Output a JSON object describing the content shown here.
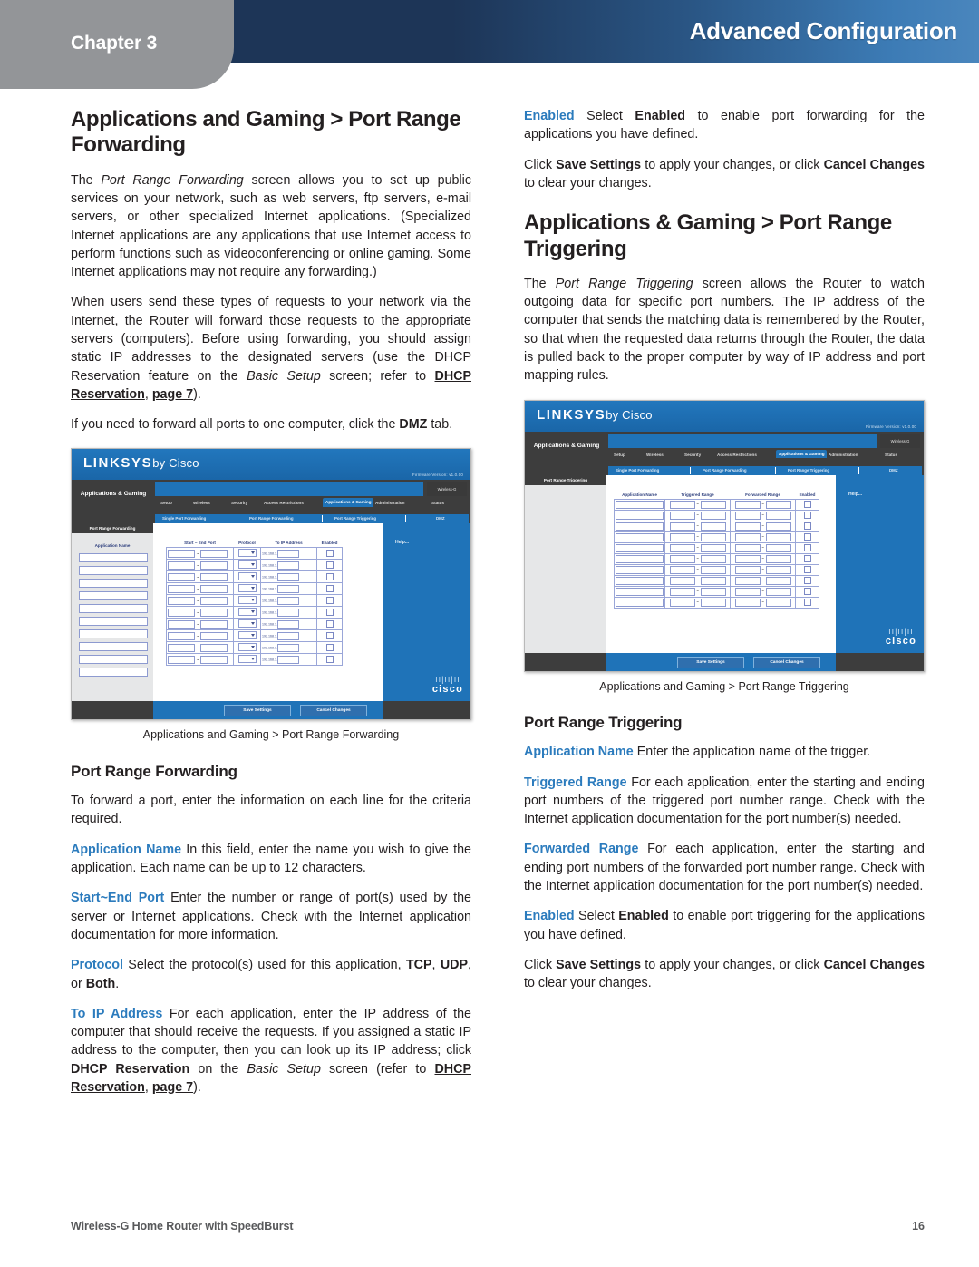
{
  "header": {
    "chapter_label": "Chapter 3",
    "title": "Advanced Configuration",
    "band_start_color": "#1d3557",
    "band_end_color": "#4a86bd",
    "chapter_tab_color": "#939598"
  },
  "accent_color": "#2b7bbd",
  "left_column": {
    "heading": "Applications and Gaming > Port Range Forwarding",
    "para_1_a": "The ",
    "para_1_em": "Port Range Forwarding",
    "para_1_b": " screen allows you to set up public services on your network, such as web servers, ftp servers, e-mail servers, or other specialized Internet applications. (Specialized Internet applications are any applications that use Internet access to perform functions such as videoconferencing or online gaming. Some Internet applications may not require any forwarding.)",
    "para_2_a": "When users send these types of requests to your network via the Internet, the Router will forward those requests to the appropriate servers (computers). Before using forwarding, you should assign static IP addresses to the designated servers (use the DHCP Reservation feature on the ",
    "para_2_em": "Basic Setup",
    "para_2_b": " screen; refer to ",
    "para_2_link1": "DHCP Reservation",
    "para_2_c": ", ",
    "para_2_link2": "page 7",
    "para_2_d": ").",
    "para_3_a": "If you need to forward all ports to one computer, click the ",
    "para_3_bold": "DMZ",
    "para_3_b": " tab.",
    "figure_caption": "Applications and Gaming > Port Range Forwarding",
    "subheading": "Port Range Forwarding",
    "para_4": "To forward a port, enter the information on each line for the criteria required.",
    "item_app_name_label": "Application Name",
    "item_app_name_text": " In this field, enter the name you wish to give the application. Each name can be up to 12 characters.",
    "item_port_label": "Start~End Port",
    "item_port_text": " Enter the number or range of port(s) used by the server or Internet applications. Check with the Internet application documentation for more information.",
    "item_protocol_label": "Protocol",
    "item_protocol_text_a": " Select the protocol(s) used for this application, ",
    "item_protocol_tcp": "TCP",
    "item_protocol_sep1": ", ",
    "item_protocol_udp": "UDP",
    "item_protocol_sep2": ", or ",
    "item_protocol_both": "Both",
    "item_protocol_end": ".",
    "item_ip_label": "To IP Address",
    "item_ip_text_a": " For each application, enter the IP address of the computer that should receive the requests. If you assigned a static IP address to the computer, then you can look up its IP address; click ",
    "item_ip_bold1": "DHCP Reservation",
    "item_ip_text_b": " on the ",
    "item_ip_em": "Basic Setup",
    "item_ip_text_c": " screen (refer to ",
    "item_ip_link1": "DHCP Reservation",
    "item_ip_text_d": ", ",
    "item_ip_link2": "page 7",
    "item_ip_text_e": ")."
  },
  "right_column": {
    "para_0_label": "Enabled",
    "para_0_a": " Select ",
    "para_0_bold": "Enabled",
    "para_0_b": " to enable port forwarding for the applications you have defined.",
    "para_save_a": "Click ",
    "para_save_bold1": "Save Settings",
    "para_save_b": " to apply your changes, or click ",
    "para_save_bold2": "Cancel Changes",
    "para_save_c": " to clear your changes.",
    "heading": "Applications & Gaming > Port Range Triggering",
    "para_1_a": "The ",
    "para_1_em": "Port Range Triggering",
    "para_1_b": " screen allows the Router to watch outgoing data for specific port numbers. The IP address of the computer that sends the matching data is remembered by the Router, so that when the requested data returns through the Router, the data is pulled back to the proper computer by way of IP address and port mapping rules.",
    "figure_caption": "Applications and Gaming > Port Range Triggering",
    "subheading": "Port Range Triggering",
    "item_app_name_label": "Application Name",
    "item_app_name_text": " Enter the application name of the trigger.",
    "item_trig_label": "Triggered Range",
    "item_trig_text": " For each application, enter the starting and ending port numbers of the triggered port number range. Check with the Internet application documentation for the port number(s) needed.",
    "item_fwd_label": "Forwarded Range",
    "item_fwd_text": " For each application, enter the starting and ending port numbers of the forwarded port number range. Check with the Internet application documentation for the port number(s) needed.",
    "item_enabled_label": "Enabled",
    "item_enabled_a": " Select ",
    "item_enabled_bold": "Enabled",
    "item_enabled_b": " to enable port triggering for the applications you have defined."
  },
  "router_ui": {
    "brand": "LINKSYS",
    "brand_suffix": "by Cisco",
    "firmware": "Firmware Version: v1.0.00",
    "login_label": "Wireless-G",
    "section_title": "Applications & Gaming",
    "nav_tabs": [
      "Setup",
      "Wireless",
      "Security",
      "Access Restrictions",
      "Applications & Gaming",
      "Administration",
      "Status"
    ],
    "active_nav_tab": "Applications & Gaming",
    "sub_tabs": [
      "Single Port Forwarding",
      "Port Range Forwarding",
      "Port Range Triggering",
      "DMZ"
    ],
    "help_label": "Help...",
    "save_button": "Save Settings",
    "cancel_button": "Cancel Changes",
    "cisco_wordmark": "cisco",
    "forwarding": {
      "panel_title": "Port Range Forwarding",
      "active_sub_tab": "Port Range Forwarding",
      "col_app_name": "Application Name",
      "columns": [
        "Start ~ End Port",
        "Protocol",
        "To IP Address",
        "Enabled"
      ],
      "row_count": 10,
      "protocol_value": "Both",
      "ip_prefix": "192.168.1."
    },
    "triggering": {
      "panel_title": "Port Range Triggering",
      "active_sub_tab": "Port Range Triggering",
      "columns": [
        "Application Name",
        "Triggered Range",
        "Forwarded Range",
        "Enabled"
      ],
      "row_count": 10
    }
  },
  "footer": {
    "doc_title": "Wireless-G Home Router with SpeedBurst",
    "page_number": "16"
  }
}
